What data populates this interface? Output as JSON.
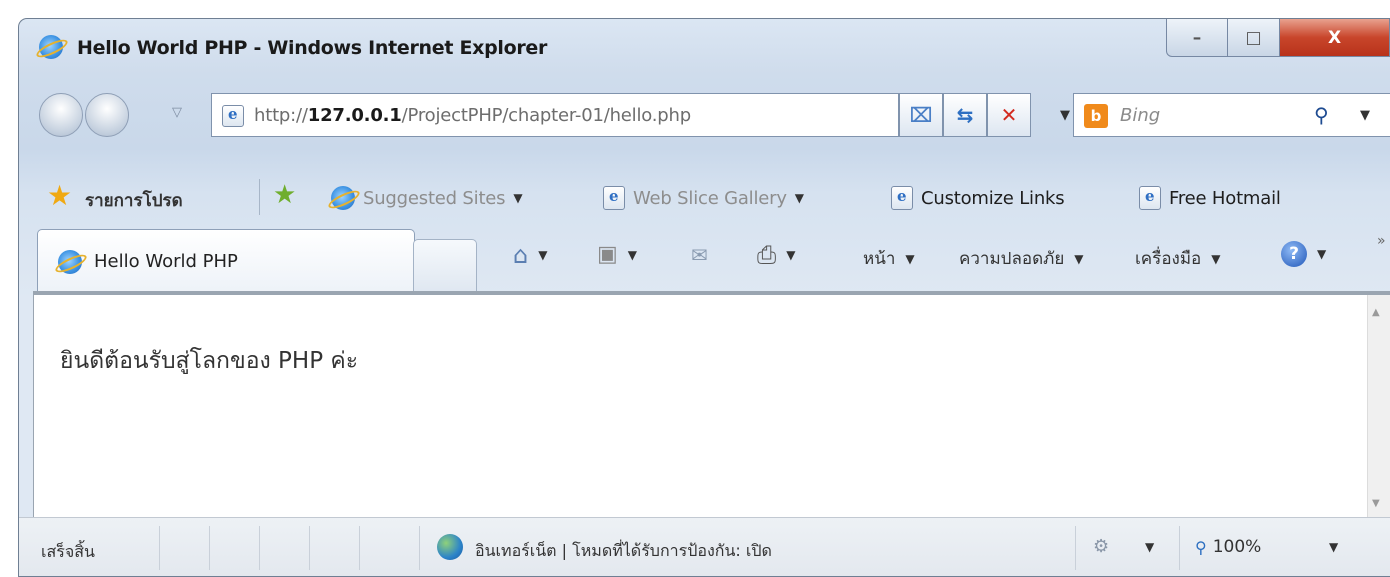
{
  "window": {
    "title": "Hello World PHP - Windows Internet Explorer",
    "controls": {
      "minimize": "–",
      "maximize": "□",
      "close": "X"
    }
  },
  "nav": {
    "address_prefix": "http://",
    "address_host": "127.0.0.1",
    "address_path": "/ProjectPHP/chapter-01/hello.php",
    "search_placeholder": "Bing",
    "bing_letter": "b"
  },
  "favorites": {
    "label": "รายการโปรด",
    "items": [
      {
        "label": "Suggested Sites"
      },
      {
        "label": "Web Slice Gallery"
      },
      {
        "label": "Customize Links"
      },
      {
        "label": "Free Hotmail"
      }
    ]
  },
  "tab": {
    "label": "Hello World PHP"
  },
  "commands": {
    "page": "หน้า",
    "safety": "ความปลอดภัย",
    "tools": "เครื่องมือ",
    "help": "?"
  },
  "content": {
    "text": "ยินดีต้อนรับสู่โลกของ PHP ค่ะ"
  },
  "status": {
    "ready": "เสร็จสิ้น",
    "zone": "อินเทอร์เน็ต | โหมดที่ได้รับการป้องกัน: เปิด",
    "zoom": "100%"
  },
  "icons": [
    "ie-icon",
    "back-icon",
    "forward-icon",
    "refresh-icon",
    "stop-icon",
    "compat-view-icon",
    "search-icon",
    "star-icon",
    "add-favorite-icon",
    "home-icon",
    "feeds-icon",
    "mail-icon",
    "print-icon",
    "help-icon",
    "globe-icon",
    "zoom-icon"
  ],
  "colors": {
    "close_button": "#c8452b",
    "bing": "#f08a1b",
    "stop": "#d32a1f",
    "chrome": "#cfdcec"
  }
}
